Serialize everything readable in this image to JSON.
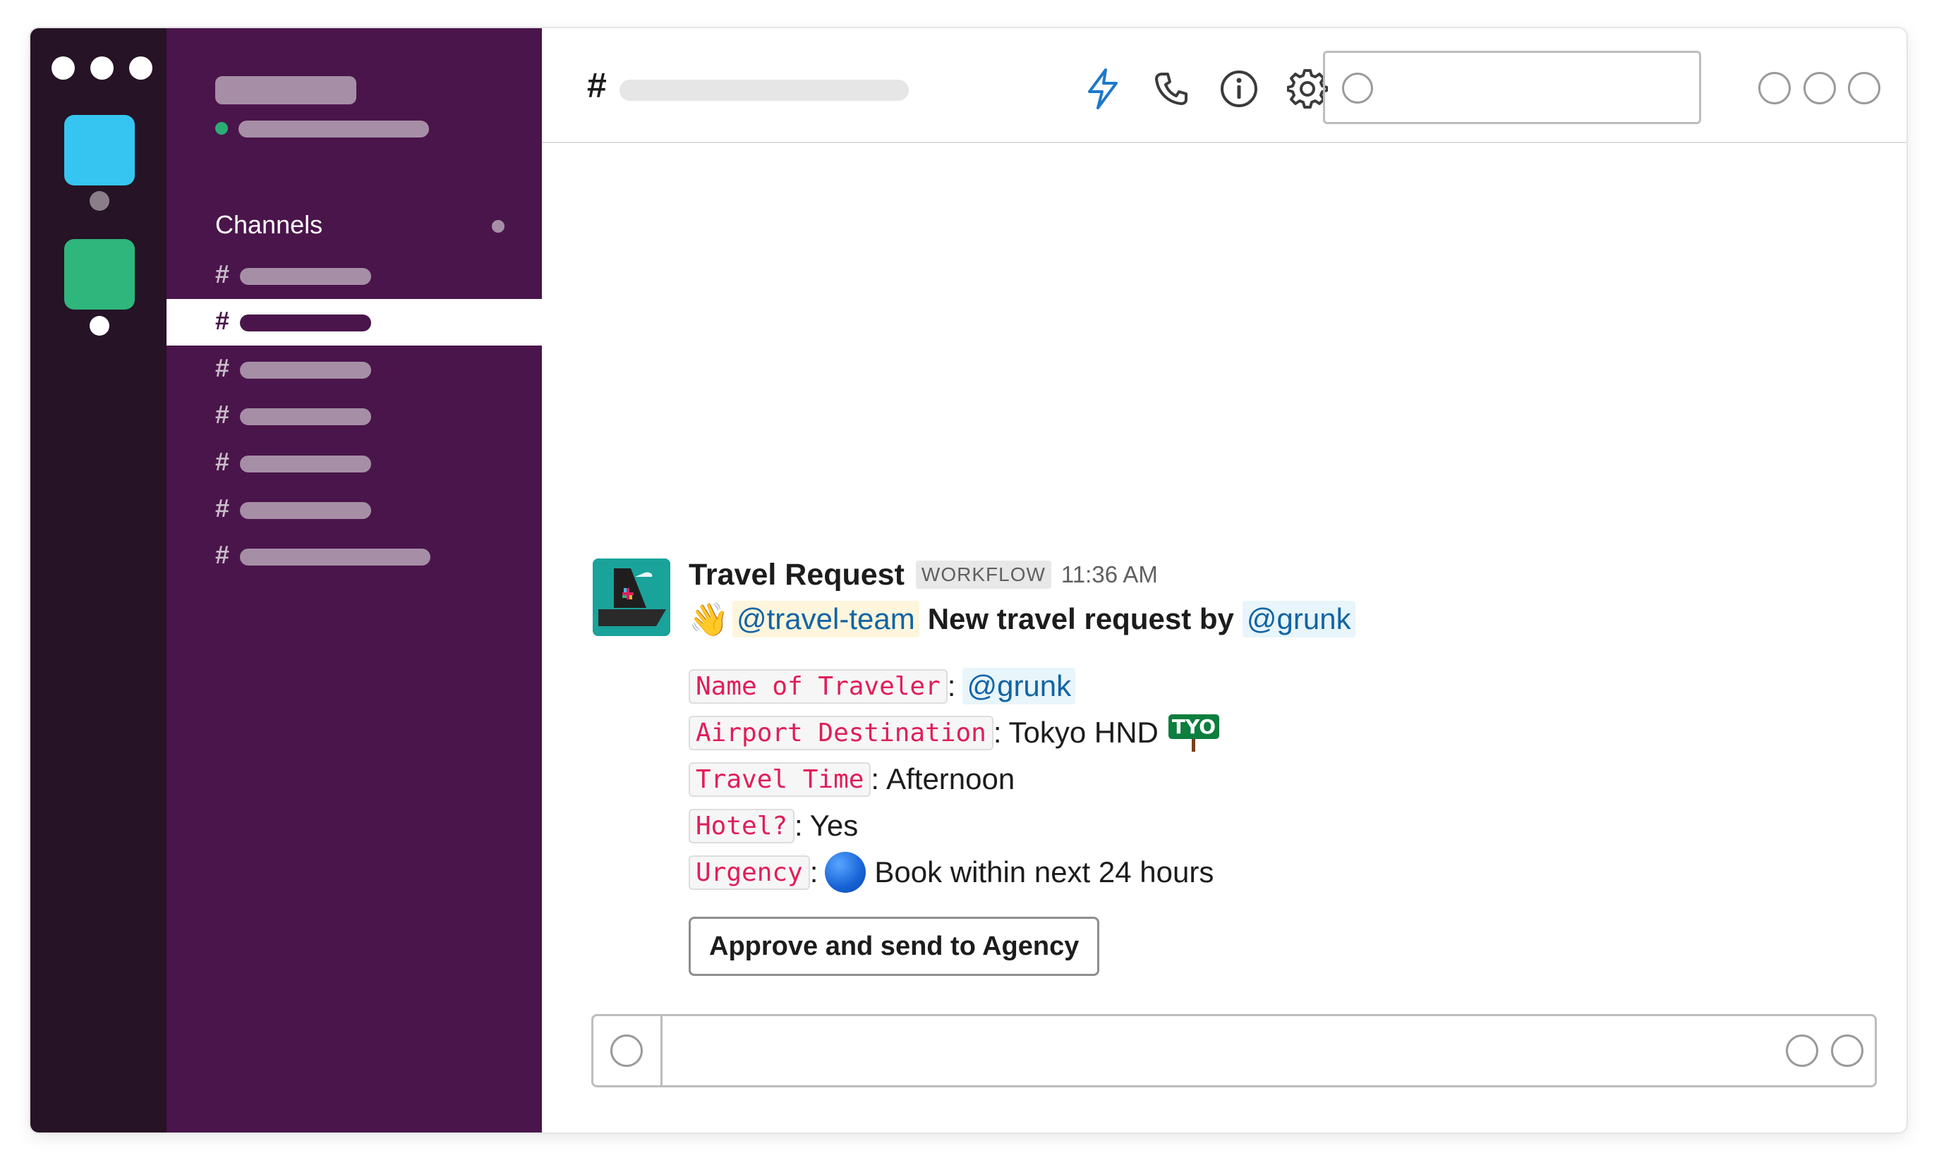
{
  "sidebar": {
    "heading": "Channels",
    "channel_hash": "#"
  },
  "header": {
    "channel_hash": "#",
    "icons": [
      "lightning-icon",
      "phone-icon",
      "info-icon",
      "gear-icon"
    ]
  },
  "message": {
    "sender": "Travel Request",
    "badge": "WORKFLOW",
    "time": "11:36 AM",
    "wave": "👋",
    "mention_team": "@travel-team",
    "intro_text": "New travel request by",
    "mention_user": "@grunk",
    "fields": {
      "traveler_label": "Name of Traveler",
      "traveler_value": "@grunk",
      "airport_label": "Airport Destination",
      "airport_value": "Tokyo HND",
      "airport_sign": "TYO",
      "time_label": "Travel Time",
      "time_value": "Afternoon",
      "hotel_label": "Hotel?",
      "hotel_value": "Yes",
      "urgency_label": "Urgency",
      "urgency_value": "Book within next 24 hours"
    },
    "approve_button": "Approve and send to Agency"
  },
  "colors": {
    "rail": "#261325",
    "sidebar": "#4a154b",
    "accent_blue": "#36c5f0",
    "accent_green": "#2eb67d",
    "mention": "#1264a3",
    "code": "#e01e5a"
  }
}
